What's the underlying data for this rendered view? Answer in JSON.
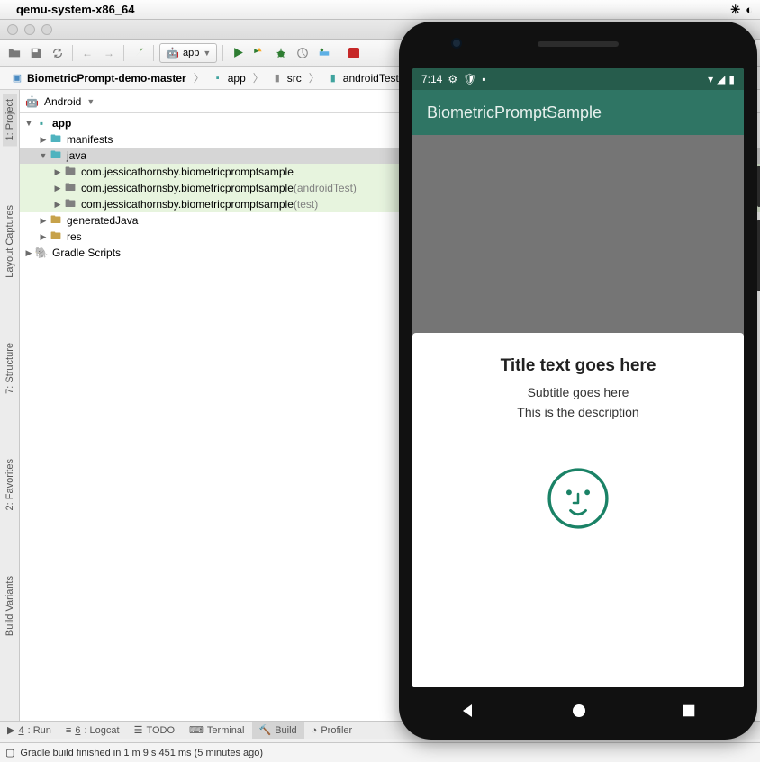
{
  "mac": {
    "title": "qemu-system-x86_64"
  },
  "toolbar": {
    "module": "app"
  },
  "crumbs": {
    "root": "BiometricPrompt-demo-master",
    "c1": "app",
    "c2": "src",
    "c3": "androidTest"
  },
  "projectView": {
    "mode": "Android"
  },
  "tree": {
    "app": "app",
    "manifests": "manifests",
    "java": "java",
    "pkg_main": "com.jessicathornsby.biometricpromptsample",
    "pkg_atest": "com.jessicathornsby.biometricpromptsample",
    "pkg_atest_suffix": " (androidTest)",
    "pkg_test": "com.jessicathornsby.biometricpromptsample",
    "pkg_test_suffix": " (test)",
    "generatedJava": "generatedJava",
    "res": "res",
    "gradle": "Gradle Scripts"
  },
  "gutter": {
    "project": "1: Project",
    "captures": "Layout Captures",
    "structure": "7: Structure",
    "favorites": "2: Favorites",
    "variants": "Build Variants"
  },
  "bottomTabs": {
    "run_pre": "",
    "run_u": "4",
    "run_post": ": Run",
    "logcat_pre": "",
    "logcat_u": "6",
    "logcat_post": ": Logcat",
    "todo": "TODO",
    "terminal": "Terminal",
    "build": "Build",
    "profiler": "Profiler"
  },
  "status": {
    "text": "Gradle build finished in 1 m 9 s 451 ms (5 minutes ago)"
  },
  "emulator": {
    "time": "7:14",
    "appTitle": "BiometricPromptSample",
    "dialog": {
      "title": "Title text goes here",
      "subtitle": "Subtitle goes here",
      "description": "This is the description"
    }
  }
}
